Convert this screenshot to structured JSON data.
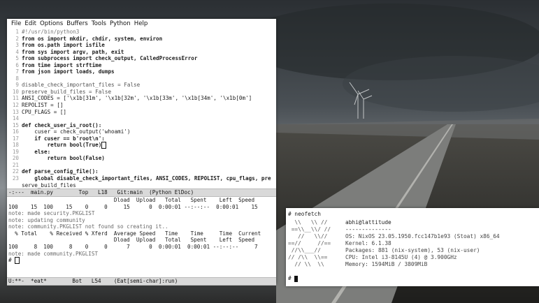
{
  "emacs": {
    "menu": [
      "File",
      "Edit",
      "Options",
      "Buffers",
      "Tools",
      "Python",
      "Help"
    ],
    "code_lines": [
      {
        "n": "1",
        "t": "#!/usr/bin/python3"
      },
      {
        "n": "2",
        "t": "from os import mkdir, chdir, system, environ"
      },
      {
        "n": "3",
        "t": "from os.path import isfile"
      },
      {
        "n": "4",
        "t": "from sys import argv, path, exit"
      },
      {
        "n": "5",
        "t": "from subprocess import check_output, CalledProcessError"
      },
      {
        "n": "6",
        "t": "from time import strftime"
      },
      {
        "n": "7",
        "t": "from json import loads, dumps"
      },
      {
        "n": "8",
        "t": ""
      },
      {
        "n": "9",
        "t": "disable_check_important_files = False"
      },
      {
        "n": "10",
        "t": "preserve_build_files = False"
      },
      {
        "n": "11",
        "t": "ANSI_CODES = ['\\x1b[31m', '\\x1b[32m', '\\x1b[33m', '\\x1b[34m', '\\x1b[0m']"
      },
      {
        "n": "12",
        "t": "REPOLIST = []"
      },
      {
        "n": "13",
        "t": "CPU_FLAGS = []"
      },
      {
        "n": "14",
        "t": ""
      },
      {
        "n": "15",
        "t": "def check_user_is_root():"
      },
      {
        "n": "16",
        "t": "    cuser = check_output('whoami')"
      },
      {
        "n": "17",
        "t": "    if cuser == b'root\\n':"
      },
      {
        "n": "18",
        "t": "        return bool(True)"
      },
      {
        "n": "19",
        "t": "    else:"
      },
      {
        "n": "20",
        "t": "        return bool(False)"
      },
      {
        "n": "21",
        "t": ""
      },
      {
        "n": "22",
        "t": "def parse_config_file():"
      },
      {
        "n": "23",
        "t": "    global disable_check_important_files, ANSI_CODES, REPOLIST, cpu_flags, pre"
      },
      {
        "n": "",
        "t": "serve_build_files"
      }
    ],
    "modeline_top": "-:---  main.py        Top   L18   Git:main  (Python ElDoc)",
    "terminal_lines": [
      "                                 Dload  Upload   Total   Spent    Left  Speed",
      "100    15  100    15    0     0     15      0  0:00:01 --:--:--  0:00:01    15",
      "note: made security.PKGLIST",
      "note: updating community",
      "note: community.PKGLIST not found so creating it..",
      "  % Total    % Received % Xferd  Average Speed   Time    Time     Time  Current",
      "                                 Dload  Upload   Total   Spent    Left  Speed",
      "100     8  100     8    0     0      7      0  0:00:01  0:00:01 --:--:--     7",
      "note: made community.PKGLIST",
      "# "
    ],
    "modeline_bottom": "U:**-  *eat*        Bot   L54    (Eat[semi-char]:run)"
  },
  "neofetch": {
    "command": "# neofetch",
    "logo": [
      "  \\\\   \\\\ //",
      " ==\\\\__\\\\/ //",
      "   //   \\\\//",
      "==//     //==",
      " //\\\\___//",
      "// /\\\\  \\\\==",
      "  // \\\\  \\\\"
    ],
    "info": [
      "abhi@lattitude",
      "--------------",
      "OS: NixOS 23.05.1950.fcc147b1e93 (Stoat) x86_64",
      "Kernel: 6.1.38",
      "Packages: 881 (nix-system), 53 (nix-user)",
      "CPU: Intel i3-8145U (4) @ 3.900GHz",
      "Memory: 1594MiB / 3809MiB"
    ],
    "prompt": "# "
  }
}
